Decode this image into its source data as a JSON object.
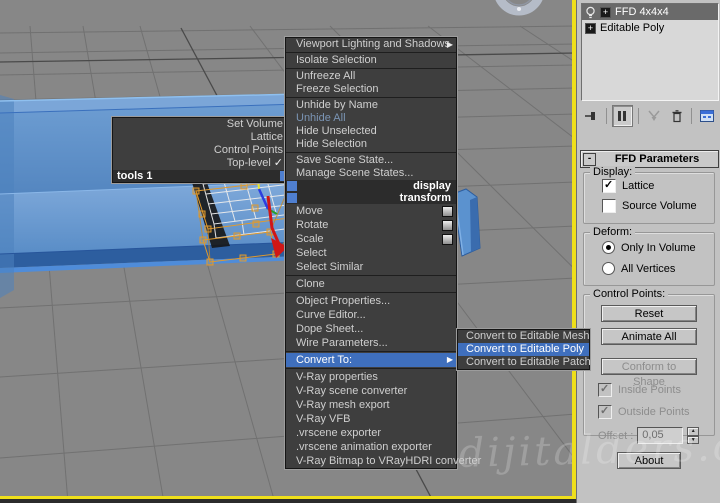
{
  "scene": {
    "watermark": "www.dijitalders.com"
  },
  "colors": {
    "menu_highlight_blue": "#3f6fbd",
    "quad_square_blue": "#4f7fd0",
    "active_viewport_border_yellow": "#efdf1b",
    "couch_blue": "#5b92cf",
    "lattice_orange": "#e09a2e",
    "gizmo_red": "#d01616",
    "panel_gray": "#c2c2c2",
    "menu_gray": "#3e3e3e"
  },
  "left_quad": {
    "header": "tools 1",
    "items": [
      {
        "label": "Set Volume"
      },
      {
        "label": "Lattice"
      },
      {
        "label": "Control Points"
      },
      {
        "label": "Top-level",
        "checked": true,
        "check_glyph": "✓"
      }
    ]
  },
  "main_menu": {
    "display_header": "display",
    "transform_header": "transform",
    "display_items": [
      {
        "label": "Viewport Lighting and Shadows",
        "submenu": true
      },
      {
        "label": "Isolate Selection"
      },
      {
        "label": "Unfreeze All"
      },
      {
        "label": "Freeze Selection"
      },
      {
        "label": "Unhide by Name"
      },
      {
        "label": "Unhide All",
        "disabled": true
      },
      {
        "label": "Hide Unselected"
      },
      {
        "label": "Hide Selection"
      },
      {
        "label": "Save Scene State..."
      },
      {
        "label": "Manage Scene States..."
      }
    ],
    "transform_items": [
      {
        "label": "Move",
        "settings_icon": true
      },
      {
        "label": "Rotate",
        "settings_icon": true
      },
      {
        "label": "Scale",
        "settings_icon": true
      },
      {
        "label": "Select"
      },
      {
        "label": "Select Similar"
      },
      {
        "label": "Clone"
      },
      {
        "label": "Object Properties..."
      },
      {
        "label": "Curve Editor..."
      },
      {
        "label": "Dope Sheet..."
      },
      {
        "label": "Wire Parameters..."
      },
      {
        "label": "Convert To:",
        "submenu": true,
        "highlighted": true
      },
      {
        "label": "V-Ray properties"
      },
      {
        "label": "V-Ray scene converter"
      },
      {
        "label": "V-Ray mesh export"
      },
      {
        "label": "V-Ray VFB"
      },
      {
        "label": ".vrscene exporter"
      },
      {
        "label": ".vrscene animation exporter"
      },
      {
        "label": "V-Ray Bitmap to VRayHDRI converter"
      }
    ]
  },
  "convert_submenu": {
    "items": [
      {
        "label": "Convert to Editable Mesh"
      },
      {
        "label": "Convert to Editable Poly",
        "highlighted": true
      },
      {
        "label": "Convert to Editable Patch"
      }
    ]
  },
  "command_panel": {
    "modifier_stack": {
      "rows": [
        {
          "label": "FFD 4x4x4",
          "selected": true
        },
        {
          "label": "Editable Poly",
          "selected": false
        }
      ],
      "toolbar_icons": [
        "pin-stack",
        "show-end-result",
        "make-unique",
        "remove-modifier",
        "configure-modifier-sets"
      ],
      "expand_glyph": "+"
    },
    "ffd_rollout": {
      "title": "FFD Parameters",
      "collapse_glyph": "-"
    },
    "display_group": {
      "legend": "Display:",
      "options": [
        {
          "label": "Lattice",
          "checked": true
        },
        {
          "label": "Source Volume",
          "checked": false
        }
      ]
    },
    "deform_group": {
      "legend": "Deform:",
      "options": [
        {
          "label": "Only In Volume",
          "selected": true
        },
        {
          "label": "All Vertices",
          "selected": false
        }
      ]
    },
    "control_points_group": {
      "legend": "Control Points:",
      "reset_label": "Reset",
      "animate_all_label": "Animate All",
      "conform_label": "Conform to Shape",
      "inside_points": {
        "label": "Inside Points",
        "checked": true,
        "disabled": true
      },
      "outside_points": {
        "label": "Outside Points",
        "checked": true,
        "disabled": true
      },
      "offset_label": "Offset :",
      "offset_value": "0,05",
      "check_glyph": "✓"
    },
    "about_label": "About"
  }
}
